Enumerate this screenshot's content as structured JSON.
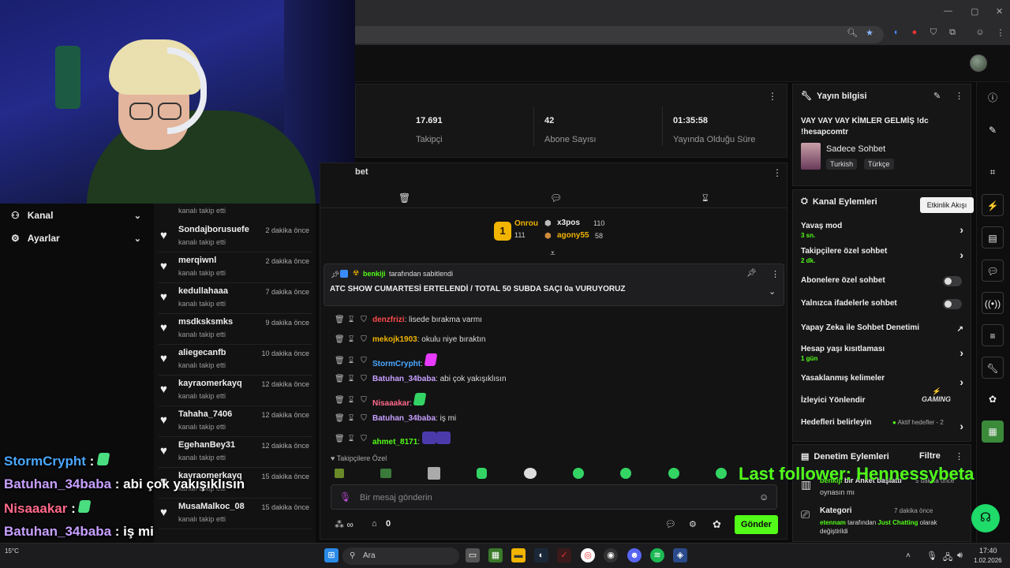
{
  "stats": {
    "followers_value": "17.691",
    "followers_label": "Takipçi",
    "subs_value": "42",
    "subs_label": "Abone Sayısı",
    "uptime_value": "01:35:58",
    "uptime_label": "Yayında Olduğu Süre"
  },
  "left_nav": [
    {
      "label": "Kanal",
      "icon": "channel-icon"
    },
    {
      "label": "Ayarlar",
      "icon": "gear-icon"
    }
  ],
  "follow_sub_label": "kanalı takip etti",
  "followers": [
    {
      "name": "Sondajborusuefe",
      "ago": "2 dakika önce"
    },
    {
      "name": "merqiwnl",
      "ago": "2 dakika önce"
    },
    {
      "name": "kedullahaaa",
      "ago": "7 dakika önce"
    },
    {
      "name": "msdksksmks",
      "ago": "9 dakika önce"
    },
    {
      "name": "aliegecanfb",
      "ago": "10 dakika önce"
    },
    {
      "name": "kayraomerkayq",
      "ago": "12 dakika önce"
    },
    {
      "name": "Tahaha_7406",
      "ago": "12 dakika önce"
    },
    {
      "name": "EgehanBey31",
      "ago": "12 dakika önce"
    },
    {
      "name": "kayraomerkayq",
      "ago": "15 dakika önce"
    },
    {
      "name": "MusaMalkoc_08",
      "ago": "15 dakika önce"
    }
  ],
  "chat": {
    "title": "bet",
    "leaderboard": [
      {
        "rank": "1",
        "name": "Onrou",
        "score": "111"
      },
      {
        "name": "x3pos",
        "score": "110"
      },
      {
        "name": "agony55",
        "score": "58"
      }
    ],
    "pinned_by_user": "benkiji",
    "pinned_by_suffix": "tarafından sabitlendi",
    "pinned_text": "ATC SHOW CUMARTESİ ERTELENDİ / TOTAL 50 SUBDA SAÇI 0a VURUYORUZ",
    "messages": [
      {
        "user": "denzfrizi",
        "color": "#ff4a4a",
        "text": "lisede bırakma varmı"
      },
      {
        "user": "mekojk1903",
        "color": "#f0b400",
        "text": "okulu niye bıraktın"
      },
      {
        "user": "StormCrypht",
        "color": "#4aa8ff",
        "text": ""
      },
      {
        "user": "Batuhan_34baba",
        "color": "#c8a0ff",
        "text": "abi çok yakışıklısın"
      },
      {
        "user": "Nisaaakar",
        "color": "#ff6a8a",
        "text": ""
      },
      {
        "user": "Batuhan_34baba",
        "color": "#c8a0ff",
        "text": "iş mi"
      },
      {
        "user": "ahmet_8171",
        "color": "#53fc18",
        "text": ""
      }
    ],
    "followers_only_label": "Takipçilere Özel",
    "input_placeholder": "Bir mesaj gönderin",
    "points_value": "0",
    "send_label": "Gönder"
  },
  "stream_info": {
    "title": "Yayın bilgisi",
    "stream_title": "VAY VAY VAY KİMLER GELMİŞ !dc !hesapcomtr",
    "category": "Sadece Sohbet",
    "tags": [
      "Turkish",
      "Türkçe"
    ]
  },
  "channel_actions": {
    "title": "Kanal Eylemleri",
    "tooltip": "Etkinlik Akışı",
    "rows": [
      {
        "label": "Yavaş mod",
        "value": "3 sn."
      },
      {
        "label": "Takipçilere özel sohbet",
        "value": "2 dk."
      },
      {
        "label": "Abonelere özel sohbet"
      },
      {
        "label": "Yalnızca ifadelerle sohbet"
      },
      {
        "label": "Yapay Zeka ile Sohbet Denetimi"
      },
      {
        "label": "Hesap yaşı kısıtlaması",
        "value": "1 gün"
      },
      {
        "label": "Yasaklanmış kelimeler"
      },
      {
        "label": "İzleyici Yönlendir"
      },
      {
        "label": "Hedefleri belirleyin",
        "value": "Aktif hedefler - 2"
      }
    ]
  },
  "moderation": {
    "title": "Denetim Eylemleri",
    "filter_label": "Filtre",
    "item1_user": "benkiji",
    "item1_text": "bir Anket başlattı",
    "item1_ago": "5 dakika önce",
    "item1_sub": "oynasın mı",
    "item2_title": "Kategori",
    "item2_ago": "7 dakika önce",
    "item2_user": "etennam",
    "item2_text": "tarafından",
    "item2_category": "Just Chatting",
    "item2_suffix": "olarak değiştirildi"
  },
  "overlay": {
    "lines": [
      {
        "user": "StormCrypht",
        "color": "#4aa8ff",
        "text": ""
      },
      {
        "user": "Batuhan_34baba",
        "color": "#c8a0ff",
        "text": "abi çok yakışıklısın"
      },
      {
        "user": "Nisaaakar",
        "color": "#ff6a8a",
        "text": ""
      },
      {
        "user": "Batuhan_34baba",
        "color": "#c8a0ff",
        "text": "iş mi"
      },
      {
        "user": "ahmet_8171",
        "color": "#53fc18",
        "text": ""
      }
    ],
    "last_follower": "Last follower: Hennessybeta",
    "gaming_logo": "GAMING"
  },
  "taskbar": {
    "search_label": "Ara",
    "time": "17:40",
    "date": "1.02.2026",
    "weather": "15°C"
  },
  "colors": {
    "accent": "#53fc18",
    "gold": "#f1b400"
  }
}
